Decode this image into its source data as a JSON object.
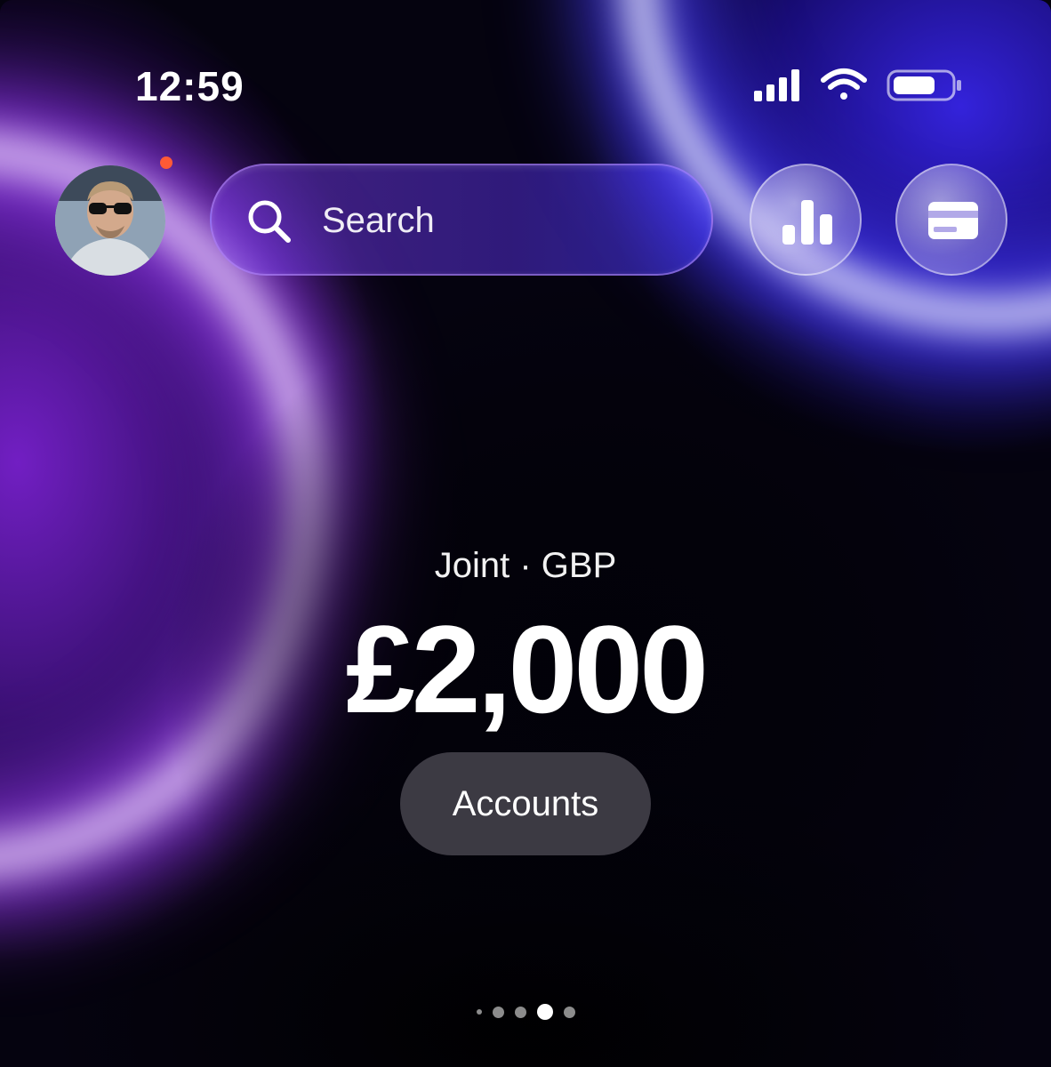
{
  "status_bar": {
    "time": "12:59"
  },
  "header": {
    "avatar_alt": "profile photo",
    "notification_color": "#ff5a36",
    "search_placeholder": "Search",
    "analytics_icon": "bar-chart-icon",
    "cards_icon": "card-icon"
  },
  "balance_panel": {
    "account_label": "Joint · GBP",
    "amount": "£2,000",
    "accounts_button_label": "Accounts"
  },
  "pagination": {
    "total_pages": 5,
    "active_index": 3
  },
  "theme": {
    "accent_purple": "#9b3cff",
    "accent_blue": "#3c3cff",
    "background": "#05030f"
  }
}
